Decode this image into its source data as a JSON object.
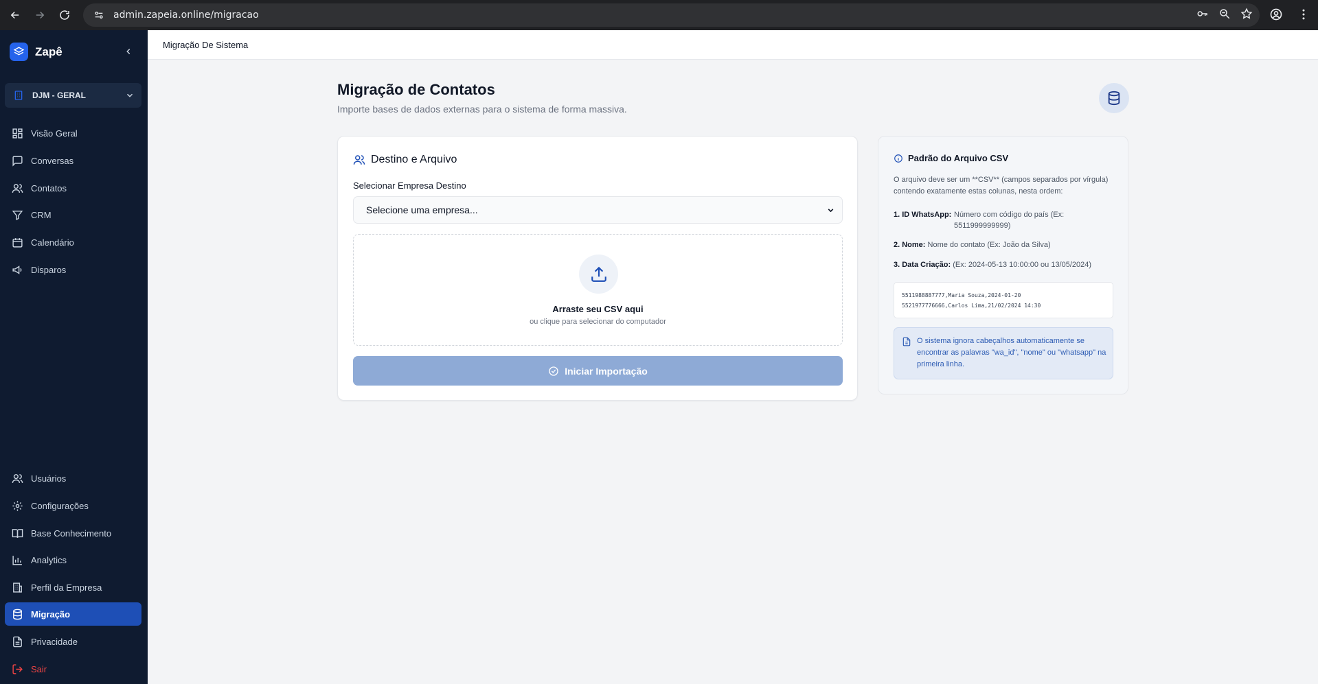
{
  "browser": {
    "url": "admin.zapeia.online/migracao",
    "icons": [
      "back-icon",
      "forward-icon",
      "reload-icon",
      "site-settings-icon",
      "key-icon",
      "zoom-icon",
      "star-icon",
      "profile-icon",
      "menu-icon"
    ]
  },
  "sidebar": {
    "brand": "Zapê",
    "company": "DJM - GERAL",
    "items": [
      {
        "label": "Visão Geral",
        "icon": "grid-icon"
      },
      {
        "label": "Conversas",
        "icon": "chat-icon"
      },
      {
        "label": "Contatos",
        "icon": "users-icon"
      },
      {
        "label": "CRM",
        "icon": "filter-icon"
      },
      {
        "label": "Calendário",
        "icon": "calendar-icon"
      },
      {
        "label": "Disparos",
        "icon": "megaphone-icon"
      }
    ],
    "bottom_items": [
      {
        "label": "Usuários",
        "icon": "users-icon"
      },
      {
        "label": "Configurações",
        "icon": "gear-icon"
      },
      {
        "label": "Base Conhecimento",
        "icon": "book-icon"
      },
      {
        "label": "Analytics",
        "icon": "bar-chart-icon"
      },
      {
        "label": "Perfil da Empresa",
        "icon": "building-icon"
      },
      {
        "label": "Migração",
        "icon": "database-icon",
        "active": true
      },
      {
        "label": "Privacidade",
        "icon": "document-icon"
      },
      {
        "label": "Sair",
        "icon": "logout-icon"
      }
    ],
    "active_color": "#1e4fb6",
    "background": "#0f1b30"
  },
  "topbar": {
    "breadcrumb": "Migração De Sistema"
  },
  "page": {
    "title": "Migração de Contatos",
    "subtitle": "Importe bases de dados externas para o sistema de forma massiva."
  },
  "form": {
    "section_title": "Destino e Arquivo",
    "company_label": "Selecionar Empresa Destino",
    "company_placeholder": "Selecione uma empresa...",
    "dropzone_title": "Arraste seu CSV aqui",
    "dropzone_subtitle": "ou clique para selecionar do computador",
    "import_button": "Iniciar Importação"
  },
  "csv_info": {
    "title": "Padrão do Arquivo CSV",
    "description": "O arquivo deve ser um **CSV** (campos separados por vírgula) contendo exatamente estas colunas, nesta ordem:",
    "columns": [
      {
        "key": "1. ID WhatsApp:",
        "value": "Número com código do país (Ex: 5511999999999)"
      },
      {
        "key": "2. Nome:",
        "value": "Nome do contato (Ex: João da Silva)"
      },
      {
        "key": "3. Data Criação:",
        "value": "(Ex: 2024-05-13 10:00:00 ou 13/05/2024)"
      }
    ],
    "example_lines": [
      "5511988887777,Maria Souza,2024-01-20",
      "5521977776666,Carlos Lima,21/02/2024 14:30"
    ],
    "note": "O sistema ignora cabeçalhos automaticamente se encontrar as palavras \"wa_id\", \"nome\" ou \"whatsapp\" na primeira linha."
  }
}
